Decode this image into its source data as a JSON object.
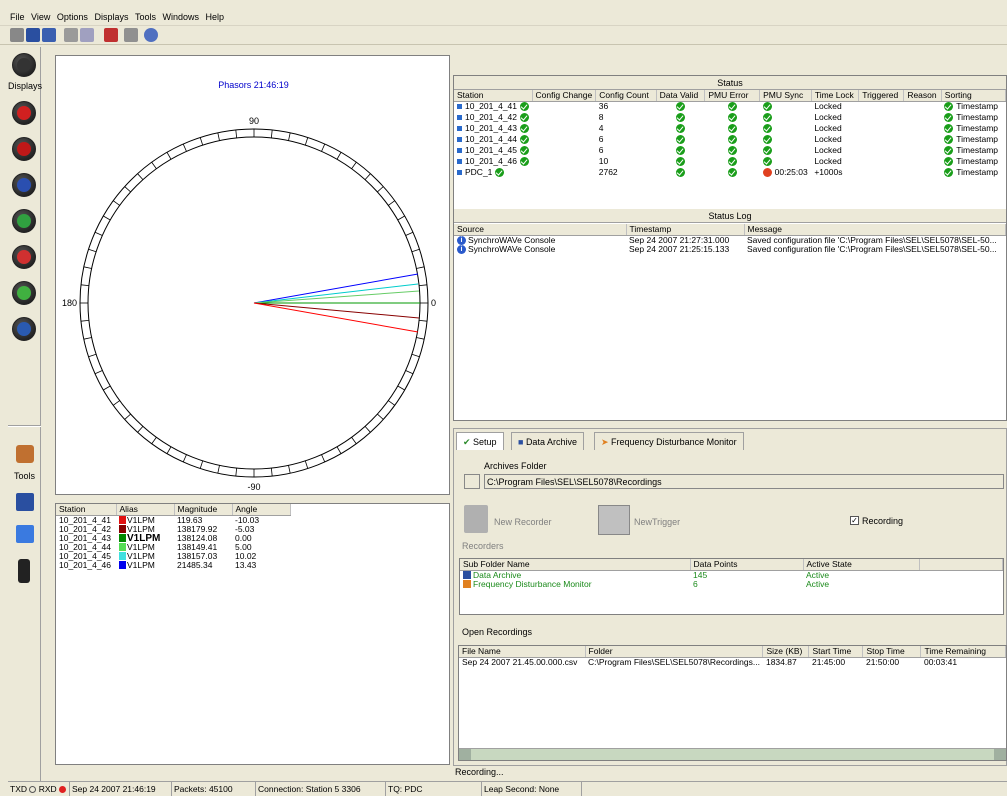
{
  "menu": [
    "File",
    "View",
    "Options",
    "Displays",
    "Tools",
    "Windows",
    "Help"
  ],
  "sidebar": {
    "displays_label": "Displays",
    "tools_label": "Tools"
  },
  "phasor": {
    "title": "Phasors 21:46:19",
    "labels": {
      "top": "90",
      "bottom": "-90",
      "left": "180",
      "right": "0"
    },
    "colors": {
      "blue": "#0000ff",
      "cyan": "#00cccc",
      "lightgreen": "#66cc66",
      "green": "#009900",
      "darkred": "#880000",
      "red": "#ff0000"
    }
  },
  "phasor_table": {
    "headers": [
      "Station",
      "Alias",
      "Magnitude",
      "Angle"
    ],
    "rows": [
      {
        "station": "10_201_4_41",
        "alias": "V1LPM",
        "magnitude": "119.63",
        "angle": "-10.03",
        "color": "#e01010"
      },
      {
        "station": "10_201_4_42",
        "alias": "V1LPM",
        "magnitude": "138179.92",
        "angle": "-5.03",
        "color": "#880000"
      },
      {
        "station": "10_201_4_43",
        "alias": "V1LPM",
        "magnitude": "138124.08",
        "angle": "0.00",
        "color": "#008800"
      },
      {
        "station": "10_201_4_44",
        "alias": "V1LPM",
        "magnitude": "138149.41",
        "angle": "5.00",
        "color": "#55dd55"
      },
      {
        "station": "10_201_4_45",
        "alias": "V1LPM",
        "magnitude": "138157.03",
        "angle": "10.02",
        "color": "#40e0e0"
      },
      {
        "station": "10_201_4_46",
        "alias": "V1LPM",
        "magnitude": "21485.34",
        "angle": "13.43",
        "color": "#0000ee"
      }
    ]
  },
  "status": {
    "title": "Status",
    "headers": [
      "Station",
      "Config Change",
      "Config Count",
      "Data Valid",
      "PMU Error",
      "PMU Sync",
      "Time Lock",
      "Triggered",
      "Reason",
      "Sorting"
    ],
    "rows": [
      {
        "station": "10_201_4_41",
        "count": "36",
        "sync_time": "",
        "lock": "Locked",
        "sorting": "Timestamp"
      },
      {
        "station": "10_201_4_42",
        "count": "8",
        "sync_time": "",
        "lock": "Locked",
        "sorting": "Timestamp"
      },
      {
        "station": "10_201_4_43",
        "count": "4",
        "sync_time": "",
        "lock": "Locked",
        "sorting": "Timestamp"
      },
      {
        "station": "10_201_4_44",
        "count": "6",
        "sync_time": "",
        "lock": "Locked",
        "sorting": "Timestamp"
      },
      {
        "station": "10_201_4_45",
        "count": "6",
        "sync_time": "",
        "lock": "Locked",
        "sorting": "Timestamp"
      },
      {
        "station": "10_201_4_46",
        "count": "10",
        "sync_time": "",
        "lock": "Locked",
        "sorting": "Timestamp"
      },
      {
        "station": "PDC_1",
        "count": "2762",
        "sync_time": "00:25:03",
        "lock": "+1000s",
        "sorting": "Timestamp"
      }
    ]
  },
  "status_log": {
    "title": "Status Log",
    "headers": [
      "Source",
      "Timestamp",
      "Message"
    ],
    "rows": [
      {
        "source": "SynchroWAVe Console",
        "timestamp": "Sep 24 2007  21:27:31.000",
        "message": "Saved configuration file 'C:\\Program Files\\SEL\\SEL5078\\SEL-50..."
      },
      {
        "source": "SynchroWAVe Console",
        "timestamp": "Sep 24 2007  21:25:15.133",
        "message": "Saved configuration file 'C:\\Program Files\\SEL\\SEL5078\\SEL-50..."
      }
    ]
  },
  "tabs": [
    "Setup",
    "Data Archive",
    "Frequency Disturbance Monitor"
  ],
  "setup": {
    "archives_folder_label": "Archives Folder",
    "archives_folder_value": "C:\\Program Files\\SEL\\SEL5078\\Recordings",
    "new_recorder": "New Recorder",
    "new_trigger": "NewTrigger",
    "recording_checkbox": "Recording",
    "recorders_label": "Recorders",
    "sub_headers": [
      "Sub Folder Name",
      "Data Points",
      "Active State"
    ],
    "sub_rows": [
      {
        "name": "Data Archive",
        "points": "145",
        "state": "Active"
      },
      {
        "name": "Frequency Disturbance Monitor",
        "points": "6",
        "state": "Active"
      }
    ],
    "open_recordings_label": "Open Recordings",
    "rec_headers": [
      "File Name",
      "Folder",
      "Size (KB)",
      "Start Time",
      "Stop Time",
      "Time Remaining"
    ],
    "rec_rows": [
      {
        "file": "Sep 24 2007 21.45.00.000.csv",
        "folder": "C:\\Program Files\\SEL\\SEL5078\\Recordings...",
        "size": "1834.87",
        "start": "21:45:00",
        "stop": "21:50:00",
        "remaining": "00:03:41"
      }
    ]
  },
  "status_line": "Recording...",
  "statusbar": {
    "txd": "TXD",
    "rxd": "RXD",
    "datetime": "Sep 24 2007  21:46:19",
    "packets": "Packets: 45100",
    "connection": "Connection: Station 5 3306",
    "tq": "TQ: PDC",
    "leap": "Leap Second: None"
  }
}
